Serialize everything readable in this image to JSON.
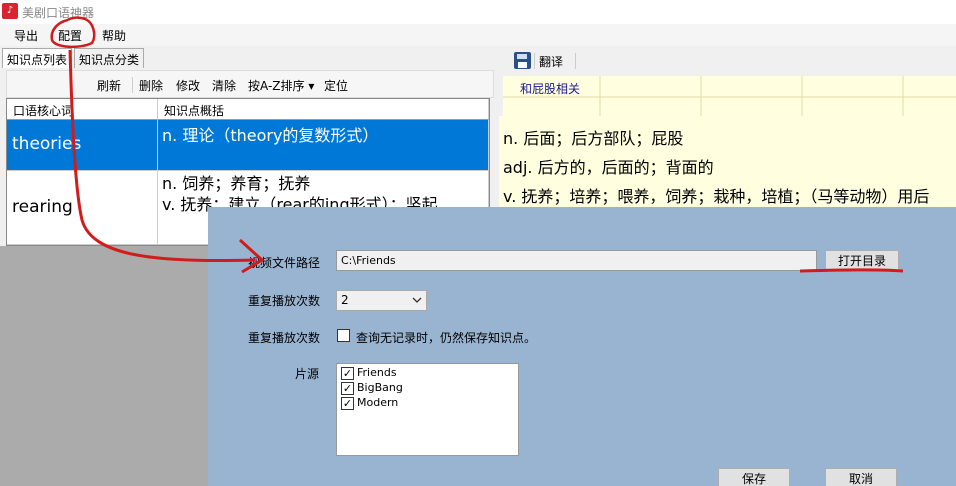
{
  "window": {
    "title": "美剧口语神器"
  },
  "menu": {
    "export": "导出",
    "config": "配置",
    "help": "帮助"
  },
  "left_tabs": {
    "tab_list": "知识点列表",
    "tab_category": "知识点分类"
  },
  "left_toolbar": {
    "refresh": "刷新",
    "delete": "删除",
    "modify": "修改",
    "clear": "清除",
    "sort": "按A-Z排序",
    "sort_arrow": "▾",
    "locate": "定位"
  },
  "grid": {
    "headers": [
      "口语核心词",
      "知识点概括"
    ],
    "rows": [
      {
        "word": "theories",
        "summary": [
          "n. 理论（theory的复数形式）"
        ]
      },
      {
        "word": "rearing",
        "summary": [
          "n. 饲养；养育；抚养",
          "v. 抚养；建立（rear的ing形式）；竖起"
        ]
      }
    ]
  },
  "right_toolbar": {
    "translate": "翻译"
  },
  "right_grid": {
    "item": "和屁股相关"
  },
  "definition": {
    "lines": [
      "n. 后面；后方部队；屁股",
      "adj. 后方的，后面的；背面的",
      "v. 抚养；培养；喂养，饲养；栽种，培植；（马等动物）用后"
    ]
  },
  "dialog": {
    "video_path_label": "视频文件路径",
    "video_path_value": "C:\\Friends",
    "open_dir_button": "打开目录",
    "repeat_label": "重复播放次数",
    "repeat_value": "2",
    "repeat_label2": "重复播放次数",
    "save_when_empty": "查询无记录时，仍然保存知识点。",
    "source_label": "片源",
    "sources": [
      {
        "name": "Friends",
        "checked": true
      },
      {
        "name": "BigBang",
        "checked": true
      },
      {
        "name": "Modern",
        "checked": true
      }
    ],
    "save_button": "保存",
    "cancel_button": "取消"
  },
  "colors": {
    "selected_row": "#0078d7",
    "dialog_bg": "#99b4d1",
    "annotation": "#d21c1c"
  }
}
